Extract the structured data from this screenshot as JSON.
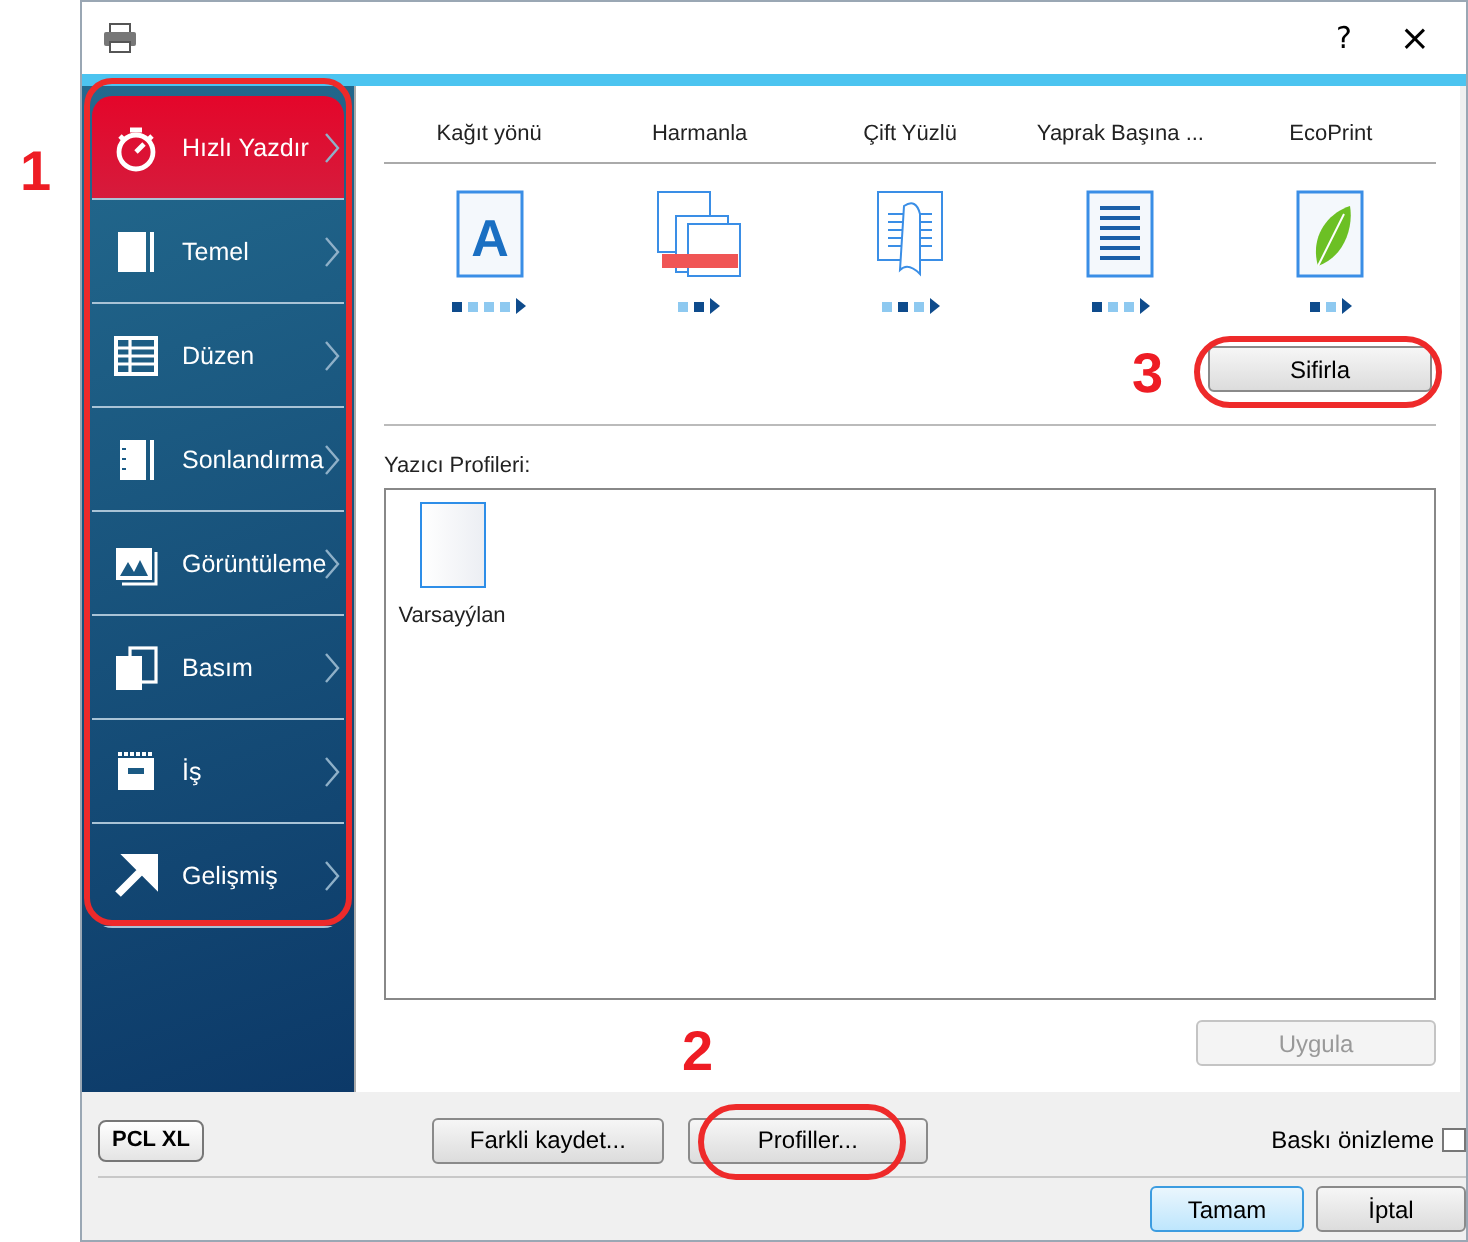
{
  "window": {
    "help": "?",
    "close": "×"
  },
  "sidebar": {
    "items": [
      {
        "label": "Hızlı Yazdır",
        "selected": true
      },
      {
        "label": "Temel",
        "selected": false
      },
      {
        "label": "Düzen",
        "selected": false
      },
      {
        "label": "Sonlandırma",
        "selected": false
      },
      {
        "label": "Görüntüleme",
        "selected": false
      },
      {
        "label": "Basım",
        "selected": false
      },
      {
        "label": "İş",
        "selected": false
      },
      {
        "label": "Gelişmiş",
        "selected": false
      }
    ]
  },
  "quick_print": {
    "options": [
      {
        "label": "Kağıt yönü",
        "icon_text": "A",
        "steps": [
          {
            "selected": true
          },
          {
            "selected": false
          },
          {
            "selected": false
          },
          {
            "selected": false
          }
        ]
      },
      {
        "label": "Harmanla",
        "steps": [
          {
            "selected": false
          },
          {
            "selected": true
          }
        ]
      },
      {
        "label": "Çift Yüzlü",
        "steps": [
          {
            "selected": false
          },
          {
            "selected": true
          },
          {
            "selected": false
          }
        ]
      },
      {
        "label": "Yaprak Başına ...",
        "steps": [
          {
            "selected": true
          },
          {
            "selected": false
          },
          {
            "selected": false
          }
        ]
      },
      {
        "label": "EcoPrint",
        "steps": [
          {
            "selected": true
          },
          {
            "selected": false
          }
        ]
      }
    ],
    "reset_button": "Sifirla"
  },
  "profiles": {
    "label": "Yazıcı Profileri:",
    "items": [
      {
        "label": "Varsayýlan"
      }
    ],
    "apply_button": {
      "label": "Uygula",
      "disabled": true
    }
  },
  "footer": {
    "pdl_badge": "PCL XL",
    "save_as_button": "Farkli kaydet...",
    "profiles_button": "Profiller...",
    "preview": {
      "label": "Baskı önizleme",
      "checked": false
    },
    "ok_button": "Tamam",
    "cancel_button": "İptal"
  },
  "annotations": [
    {
      "number": "1"
    },
    {
      "number": "2"
    },
    {
      "number": "3"
    }
  ]
}
